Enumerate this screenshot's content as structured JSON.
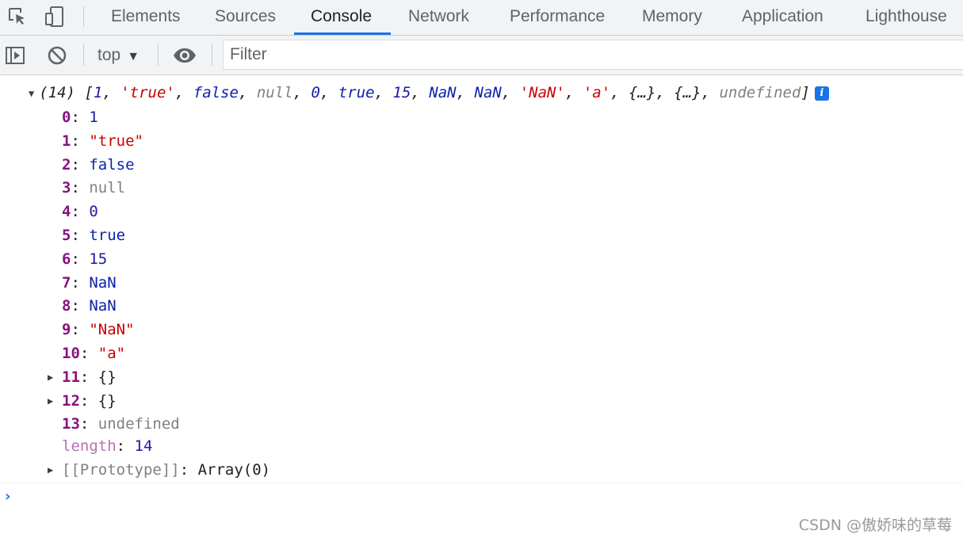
{
  "tabs": [
    "Elements",
    "Sources",
    "Console",
    "Network",
    "Performance",
    "Memory",
    "Application",
    "Lighthouse"
  ],
  "active_tab": "Console",
  "toolbar": {
    "context_label": "top",
    "filter_placeholder": "Filter"
  },
  "array_summary": {
    "count": "(14)",
    "open": " [",
    "items": [
      {
        "text": "1",
        "type": "num"
      },
      {
        "text": "'true'",
        "type": "str"
      },
      {
        "text": "false",
        "type": "kw"
      },
      {
        "text": "null",
        "type": "nul"
      },
      {
        "text": "0",
        "type": "num"
      },
      {
        "text": "true",
        "type": "kw"
      },
      {
        "text": "15",
        "type": "num"
      },
      {
        "text": "NaN",
        "type": "kw"
      },
      {
        "text": "NaN",
        "type": "kw"
      },
      {
        "text": "'NaN'",
        "type": "str"
      },
      {
        "text": "'a'",
        "type": "str"
      },
      {
        "text": "{…}",
        "type": "plain"
      },
      {
        "text": "{…}",
        "type": "plain"
      },
      {
        "text": "undefined",
        "type": "nul"
      }
    ],
    "close": "]",
    "info_badge": "i"
  },
  "entries": [
    {
      "key": "0",
      "value": "1",
      "type": "num",
      "expandable": false
    },
    {
      "key": "1",
      "value": "\"true\"",
      "type": "str",
      "expandable": false
    },
    {
      "key": "2",
      "value": "false",
      "type": "kw",
      "expandable": false
    },
    {
      "key": "3",
      "value": "null",
      "type": "nul",
      "expandable": false
    },
    {
      "key": "4",
      "value": "0",
      "type": "num",
      "expandable": false
    },
    {
      "key": "5",
      "value": "true",
      "type": "kw",
      "expandable": false
    },
    {
      "key": "6",
      "value": "15",
      "type": "num",
      "expandable": false
    },
    {
      "key": "7",
      "value": "NaN",
      "type": "kw",
      "expandable": false
    },
    {
      "key": "8",
      "value": "NaN",
      "type": "kw",
      "expandable": false
    },
    {
      "key": "9",
      "value": "\"NaN\"",
      "type": "str",
      "expandable": false
    },
    {
      "key": "10",
      "value": "\"a\"",
      "type": "str",
      "expandable": false
    },
    {
      "key": "11",
      "value": "{}",
      "type": "plain",
      "expandable": true
    },
    {
      "key": "12",
      "value": "{}",
      "type": "plain",
      "expandable": true
    },
    {
      "key": "13",
      "value": "undefined",
      "type": "nul",
      "expandable": false
    }
  ],
  "length": {
    "key": "length",
    "value": "14"
  },
  "prototype": {
    "key": "[[Prototype]]",
    "value": "Array(0)"
  },
  "watermark": "CSDN @傲娇味的草莓"
}
